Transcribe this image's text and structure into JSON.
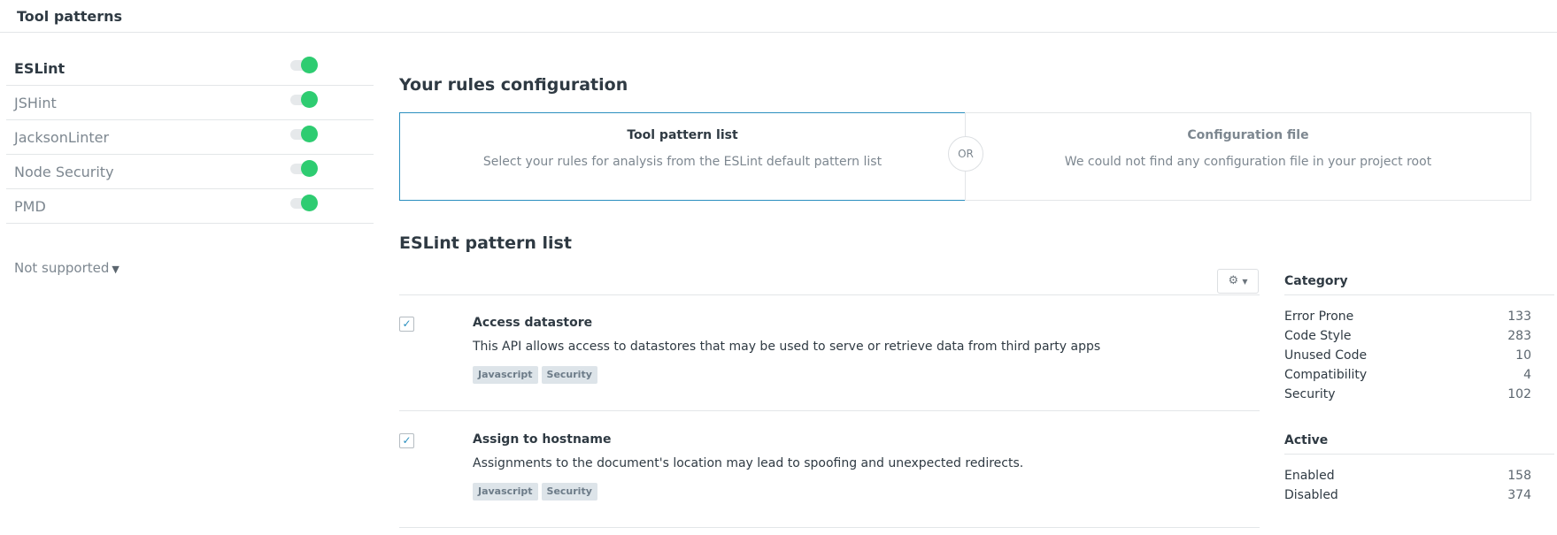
{
  "header": {
    "title": "Tool patterns"
  },
  "sidebar": {
    "tools": [
      {
        "name": "ESLint",
        "enabled": true,
        "active": true
      },
      {
        "name": "JSHint",
        "enabled": true,
        "active": false
      },
      {
        "name": "JacksonLinter",
        "enabled": true,
        "active": false
      },
      {
        "name": "Node Security",
        "enabled": true,
        "active": false
      },
      {
        "name": "PMD",
        "enabled": true,
        "active": false
      }
    ],
    "not_supported_label": "Not supported",
    "not_supported_icon": "chevron-down-icon",
    "toggle_on_color": "#2ecc71"
  },
  "config": {
    "title": "Your rules configuration",
    "option_pattern_list": {
      "title": "Tool pattern list",
      "description": "Select your rules for analysis from the ESLint default pattern list",
      "selected": true
    },
    "or_label": "OR",
    "option_config_file": {
      "title": "Configuration file",
      "description": "We could not find any configuration file in your project root",
      "selected": false
    },
    "accent_color": "#2a8fbf"
  },
  "pattern_list": {
    "title": "ESLint pattern list",
    "settings_icon": "gear-icon",
    "patterns": [
      {
        "title": "Access datastore",
        "description": "This API allows access to datastores that may be used to serve or retrieve data from third party apps",
        "tags": [
          "Javascript",
          "Security"
        ],
        "checked": true
      },
      {
        "title": "Assign to hostname",
        "description": "Assignments to the document's location may lead to spoofing and unexpected redirects.",
        "tags": [
          "Javascript",
          "Security"
        ],
        "checked": true
      }
    ]
  },
  "filters": {
    "category": {
      "title": "Category",
      "items": [
        {
          "label": "Error Prone",
          "count": "133"
        },
        {
          "label": "Code Style",
          "count": "283"
        },
        {
          "label": "Unused Code",
          "count": "10"
        },
        {
          "label": "Compatibility",
          "count": "4"
        },
        {
          "label": "Security",
          "count": "102"
        }
      ]
    },
    "active": {
      "title": "Active",
      "items": [
        {
          "label": "Enabled",
          "count": "158"
        },
        {
          "label": "Disabled",
          "count": "374"
        }
      ]
    }
  }
}
